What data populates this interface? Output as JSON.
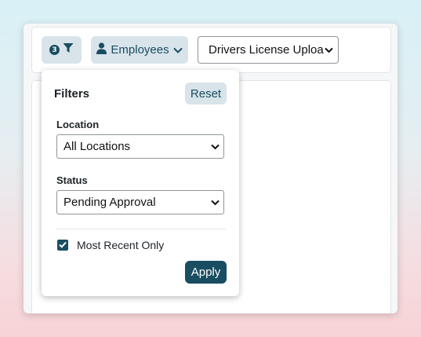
{
  "toolbar": {
    "filter_button": {
      "active_count": "3",
      "icon": "funnel-icon"
    },
    "employees_button": {
      "label": "Employees",
      "icon": "user-icon",
      "caret": "chevron-down-icon"
    },
    "document_select": {
      "value": "Drivers License Uploa"
    }
  },
  "filters_popover": {
    "title": "Filters",
    "reset_label": "Reset",
    "location": {
      "label": "Location",
      "value": "All Locations"
    },
    "status": {
      "label": "Status",
      "value": "Pending Approval"
    },
    "most_recent": {
      "label": "Most Recent Only",
      "checked": true
    },
    "apply_label": "Apply"
  },
  "colors": {
    "accent": "#194d62",
    "button_bg": "#d8e4ea"
  }
}
